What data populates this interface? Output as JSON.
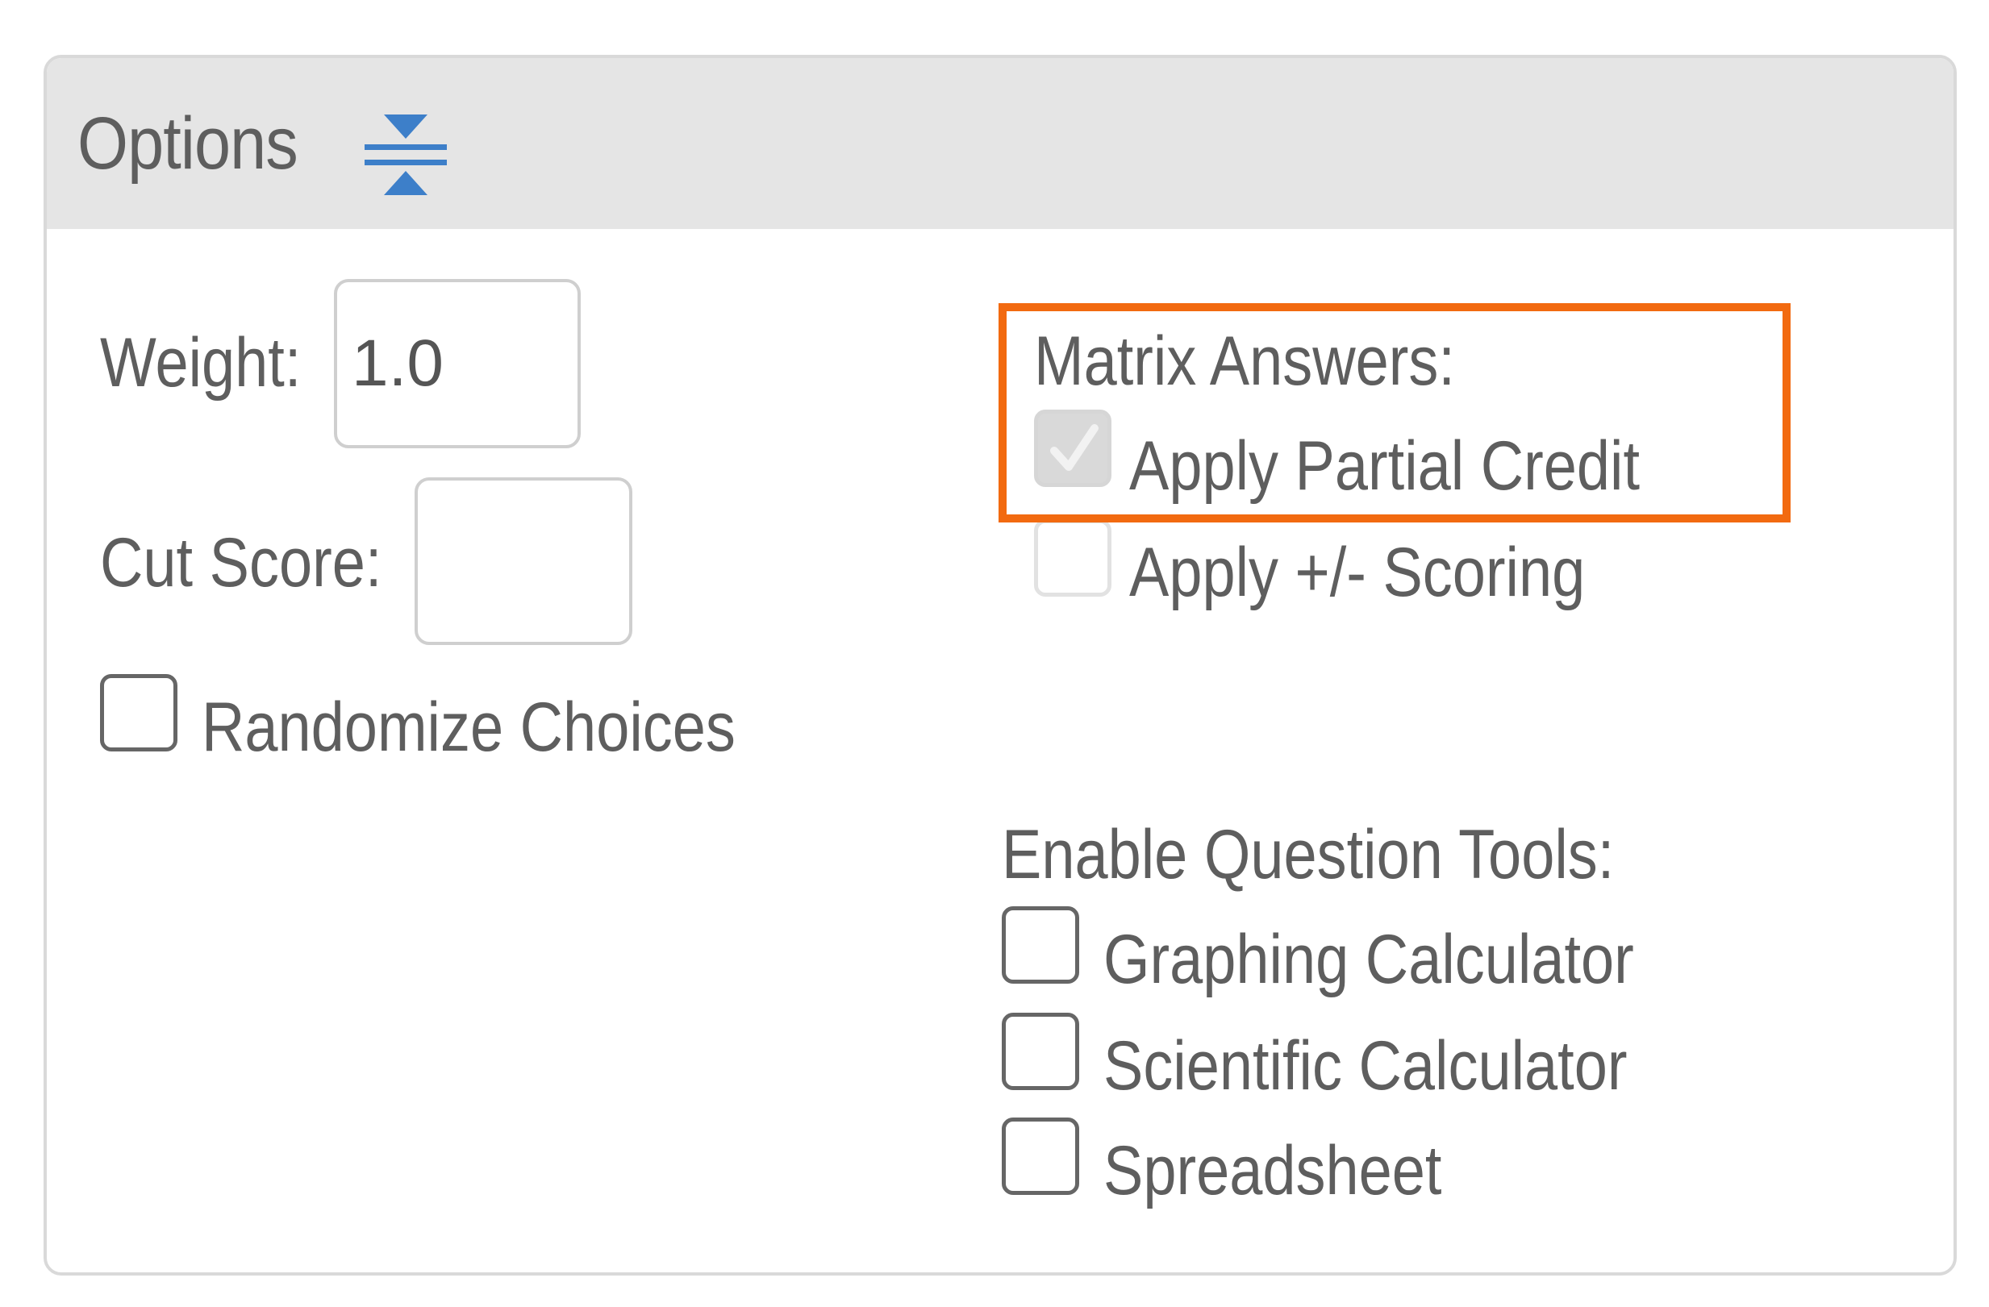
{
  "panel": {
    "title": "Options",
    "collapse_icon": "collapse-vertical-icon"
  },
  "left": {
    "weight_label": "Weight:",
    "weight_value": "1.0",
    "cut_score_label": "Cut Score:",
    "cut_score_value": "",
    "randomize_label": "Randomize Choices",
    "randomize_checked": false
  },
  "matrix": {
    "heading": "Matrix Answers:",
    "partial_credit_label": "Apply Partial Credit",
    "partial_credit_checked": true,
    "plus_minus_label": "Apply +/- Scoring",
    "plus_minus_checked": false
  },
  "tools": {
    "heading": "Enable Question Tools:",
    "items": [
      {
        "label": "Graphing Calculator",
        "checked": false
      },
      {
        "label": "Scientific Calculator",
        "checked": false
      },
      {
        "label": "Spreadsheet",
        "checked": false
      }
    ]
  },
  "colors": {
    "highlight": "#f26a10",
    "icon_blue": "#3d7fc9",
    "header_bg": "#e5e5e5"
  }
}
